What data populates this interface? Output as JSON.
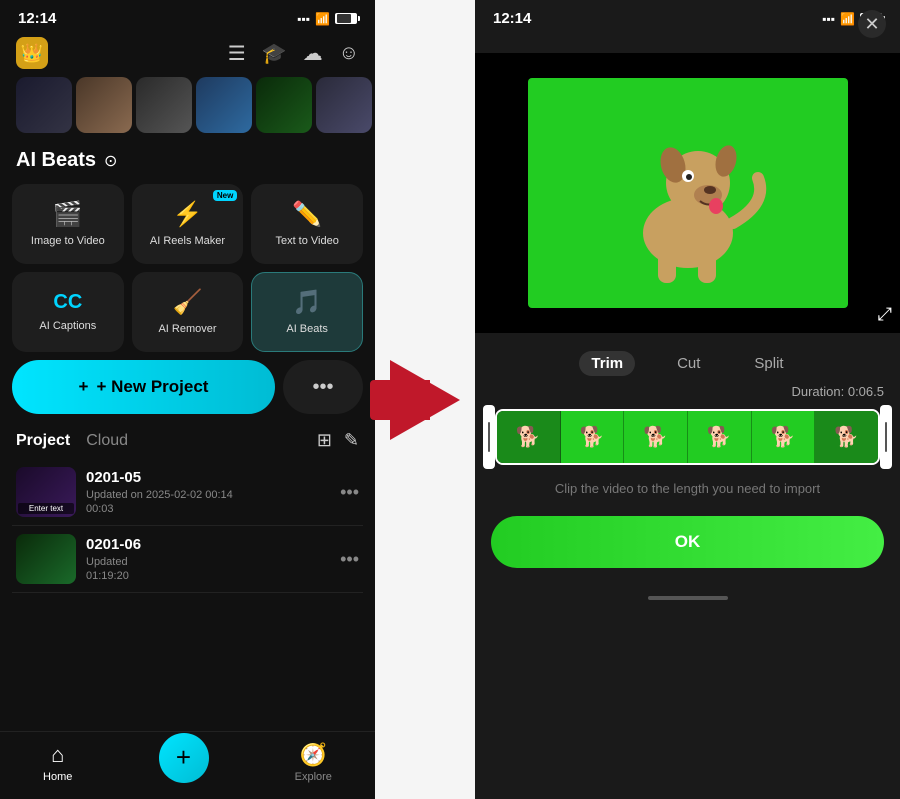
{
  "left": {
    "status": {
      "time": "12:14"
    },
    "nav_icons": [
      "≡",
      "🎓",
      "☁",
      "😊"
    ],
    "section": {
      "title": "AI Beats",
      "title_icon": "⊙"
    },
    "ai_cards": [
      {
        "id": "image-to-video",
        "icon": "🎬",
        "label": "Image to Video",
        "badge": null,
        "highlighted": false
      },
      {
        "id": "ai-reels-maker",
        "icon": "⚡",
        "label": "AI Reels Maker",
        "badge": "New",
        "highlighted": false
      },
      {
        "id": "text-to-video",
        "icon": "✏️",
        "label": "Text  to Video",
        "badge": null,
        "highlighted": false
      }
    ],
    "ai_cards_row2": [
      {
        "id": "ai-captions",
        "icon": "CC",
        "label": "AI Captions",
        "badge": null,
        "highlighted": false
      },
      {
        "id": "ai-remover",
        "icon": "🧹",
        "label": "AI Remover",
        "badge": null,
        "highlighted": false
      },
      {
        "id": "ai-beats",
        "icon": "🎵",
        "label": "AI Beats",
        "badge": null,
        "highlighted": true
      }
    ],
    "new_project_label": "+ New Project",
    "more_label": "•••",
    "project_tabs": [
      "Project",
      "Cloud"
    ],
    "projects": [
      {
        "id": "0201-05",
        "name": "0201-05",
        "updated": "Updated on 2025-02-02 00:14",
        "duration": "00:03",
        "thumb_class": "p-thumb-1",
        "enter_text": "Enter text"
      },
      {
        "id": "0201-06",
        "name": "0201-06",
        "updated": "Updated",
        "duration": "01:19:20",
        "thumb_class": "p-thumb-2",
        "enter_text": null
      }
    ],
    "bottom_nav": [
      {
        "id": "home",
        "icon": "⌂",
        "label": "Home",
        "active": true
      },
      {
        "id": "add",
        "icon": "+",
        "label": "",
        "active": false,
        "is_center": true
      },
      {
        "id": "explore",
        "icon": "🧭",
        "label": "Explore",
        "active": false
      }
    ]
  },
  "right": {
    "status": {
      "time": "12:14"
    },
    "close_label": "✕",
    "trim_tabs": [
      {
        "id": "trim",
        "label": "Trim",
        "active": true
      },
      {
        "id": "cut",
        "label": "Cut",
        "active": false
      },
      {
        "id": "split",
        "label": "Split",
        "active": false
      }
    ],
    "duration_label": "Duration:",
    "duration_value": "0:06.5",
    "clip_hint": "Clip the video to the length you need to import",
    "ok_label": "OK"
  }
}
